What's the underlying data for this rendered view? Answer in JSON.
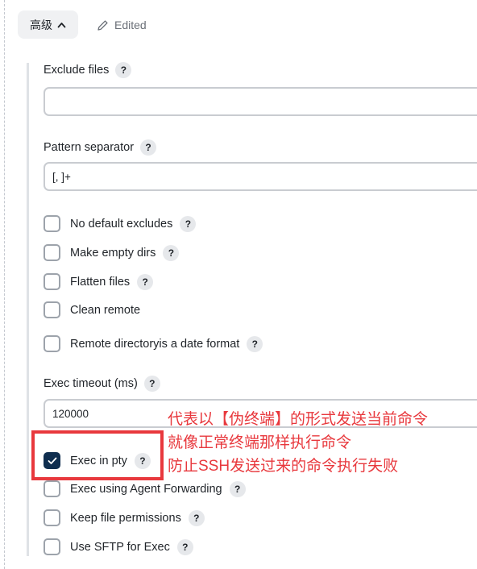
{
  "header": {
    "advanced_label": "高级",
    "edited_label": "Edited"
  },
  "fields": {
    "exclude_files": {
      "label": "Exclude files",
      "value": ""
    },
    "pattern_separator": {
      "label": "Pattern separator",
      "value": "[, ]+"
    },
    "exec_timeout": {
      "label": "Exec timeout (ms)",
      "value": "120000"
    }
  },
  "checkboxes": [
    {
      "label": "No default excludes",
      "checked": false,
      "help": true
    },
    {
      "label": "Make empty dirs",
      "checked": false,
      "help": true
    },
    {
      "label": "Flatten files",
      "checked": false,
      "help": true
    },
    {
      "label": "Clean remote",
      "checked": false,
      "help": false
    },
    {
      "label": "Remote directoryis a date format",
      "checked": false,
      "help": true
    },
    {
      "label": "Exec in pty",
      "checked": true,
      "help": true
    },
    {
      "label": "Exec using Agent Forwarding",
      "checked": false,
      "help": true
    },
    {
      "label": "Keep file permissions",
      "checked": false,
      "help": true
    },
    {
      "label": "Use SFTP for Exec",
      "checked": false,
      "help": true
    }
  ],
  "help_glyph": "?",
  "annotation": {
    "lines": [
      "代表以【伪终端】的形式发送当前命令",
      "就像正常终端那样执行命令",
      "防止SSH发送过来的命令执行失败"
    ],
    "color": "#e8383d"
  },
  "colors": {
    "checkbox_checked": "#0f2e4f",
    "annotation_red": "#e8383d"
  }
}
